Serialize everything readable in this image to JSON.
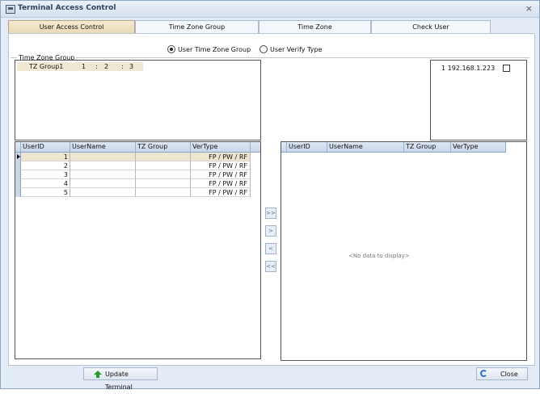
{
  "window": {
    "title": "Terminal Access Control",
    "close_symbol": "×"
  },
  "tabs": [
    {
      "label": "User Access Control",
      "active": true
    },
    {
      "label": "Time Zone Group",
      "active": false
    },
    {
      "label": "Time Zone",
      "active": false
    },
    {
      "label": "Check User",
      "active": false
    }
  ],
  "options": {
    "user_time_zone_group": "User Time Zone Group",
    "user_verify_type": "User Verify Type",
    "selected": "user_time_zone_group"
  },
  "time_zone_group": {
    "label": "Time Zone Group",
    "rows": [
      {
        "name": "TZ Group1",
        "tz1": "1",
        "sep1": ":",
        "tz2": "2",
        "sep2": ":",
        "tz3": "3"
      }
    ]
  },
  "terminals": [
    {
      "ip": "1 192.168.1.223",
      "checked": false
    }
  ],
  "left_grid": {
    "columns": [
      "UserID",
      "UserName",
      "TZ Group",
      "VerType"
    ],
    "rows": [
      {
        "userid": "1",
        "username": "",
        "tzgroup": "",
        "vertype": "FP / PW / RF"
      },
      {
        "userid": "2",
        "username": "",
        "tzgroup": "",
        "vertype": "FP / PW / RF"
      },
      {
        "userid": "3",
        "username": "",
        "tzgroup": "",
        "vertype": "FP / PW / RF"
      },
      {
        "userid": "4",
        "username": "",
        "tzgroup": "",
        "vertype": "FP / PW / RF"
      },
      {
        "userid": "5",
        "username": "",
        "tzgroup": "",
        "vertype": "FP / PW / RF"
      }
    ]
  },
  "move_buttons": {
    "all_right": ">>",
    "right": ">",
    "left": "<",
    "all_left": "<<"
  },
  "right_grid": {
    "columns": [
      "UserID",
      "UserName",
      "TZ Group",
      "VerType"
    ],
    "empty_text": "<No data to display>"
  },
  "footer": {
    "update_label": "Update Terminal",
    "close_label": "Close"
  }
}
